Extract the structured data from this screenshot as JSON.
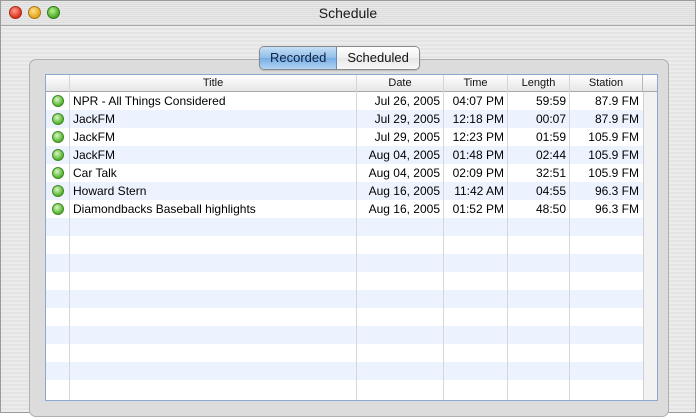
{
  "window": {
    "title": "Schedule"
  },
  "tabs": [
    {
      "label": "Recorded",
      "selected": true
    },
    {
      "label": "Scheduled",
      "selected": false
    }
  ],
  "table": {
    "columns": [
      "",
      "Title",
      "Date",
      "Time",
      "Length",
      "Station"
    ],
    "rows": [
      {
        "title": "NPR - All Things Considered",
        "date": "Jul 26, 2005",
        "time": "04:07 PM",
        "length": "59:59",
        "station": "87.9 FM"
      },
      {
        "title": "JackFM",
        "date": "Jul 29, 2005",
        "time": "12:18 PM",
        "length": "00:07",
        "station": "87.9 FM"
      },
      {
        "title": "JackFM",
        "date": "Jul 29, 2005",
        "time": "12:23 PM",
        "length": "01:59",
        "station": "105.9 FM"
      },
      {
        "title": "JackFM",
        "date": "Aug 04, 2005",
        "time": "01:48 PM",
        "length": "02:44",
        "station": "105.9 FM"
      },
      {
        "title": "Car Talk",
        "date": "Aug 04, 2005",
        "time": "02:09 PM",
        "length": "32:51",
        "station": "105.9 FM"
      },
      {
        "title": "Howard Stern",
        "date": "Aug 16, 2005",
        "time": "11:42 AM",
        "length": "04:55",
        "station": "96.3 FM"
      },
      {
        "title": "Diamondbacks Baseball highlights",
        "date": "Aug 16, 2005",
        "time": "01:52 PM",
        "length": "48:50",
        "station": "96.3 FM"
      }
    ]
  },
  "colors": {
    "accent": "#76aee6",
    "row_alt": "#edf3fe",
    "status_green": "#5cb838"
  },
  "icons": {
    "status": "recorded-status-icon",
    "close": "close-icon",
    "minimize": "minimize-icon",
    "zoom": "zoom-icon"
  }
}
